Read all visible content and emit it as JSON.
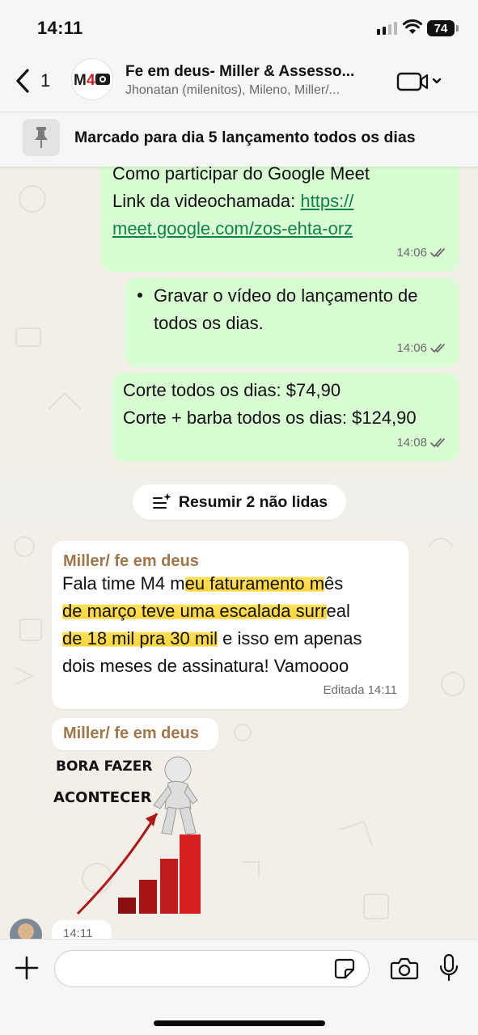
{
  "status_bar": {
    "time": "14:11",
    "battery": "74"
  },
  "header": {
    "back_count": "1",
    "avatar_text": "M4",
    "title": "Fe em deus- Miller & Assesso...",
    "members": "Jhonatan (milenitos), Mileno, Miller/..."
  },
  "pinned": {
    "text": "Marcado para dia 5 lançamento todos os dias"
  },
  "messages": [
    {
      "line1": "Como participar do Google Meet",
      "line2_prefix": "Link da videochamada: ",
      "link_part1": "https://",
      "link_part2": "meet.google.com/zos-ehta-orz",
      "time": "14:06"
    },
    {
      "bullet_line1": "Gravar o vídeo do lançamento de",
      "bullet_line2": "todos os dias.",
      "time": "14:06"
    },
    {
      "line1": "Corte todos os dias: $74,90",
      "line2": "Corte + barba todos os dias: $124,90",
      "time": "14:08"
    }
  ],
  "summary_button": {
    "label": "Resumir 2 não lidas"
  },
  "incoming": [
    {
      "sender": "Miller/ fe em deus",
      "l1a": "Fala time M4 m",
      "l1b": "eu faturamento m",
      "l1c": "ês",
      "l2a": "de março teve uma escalada surr",
      "l2b": "eal",
      "l3a": "de 18 mil pra 30  mil",
      "l3b": " e isso em apenas",
      "l4": "dois meses de assinatura! Vamoooo",
      "edited_time": "Editada 14:11"
    },
    {
      "sender": "Miller/ fe em deus",
      "sticker_line1": "BORA FAZER",
      "sticker_line2": "ACONTECER",
      "time": "14:11"
    }
  ],
  "composer": {
    "placeholder": ""
  },
  "colors": {
    "outgoing_bubble": "#d9fdd3",
    "sender_name": "#a0774a",
    "link": "#11804a",
    "highlight": "#ffd43a"
  }
}
